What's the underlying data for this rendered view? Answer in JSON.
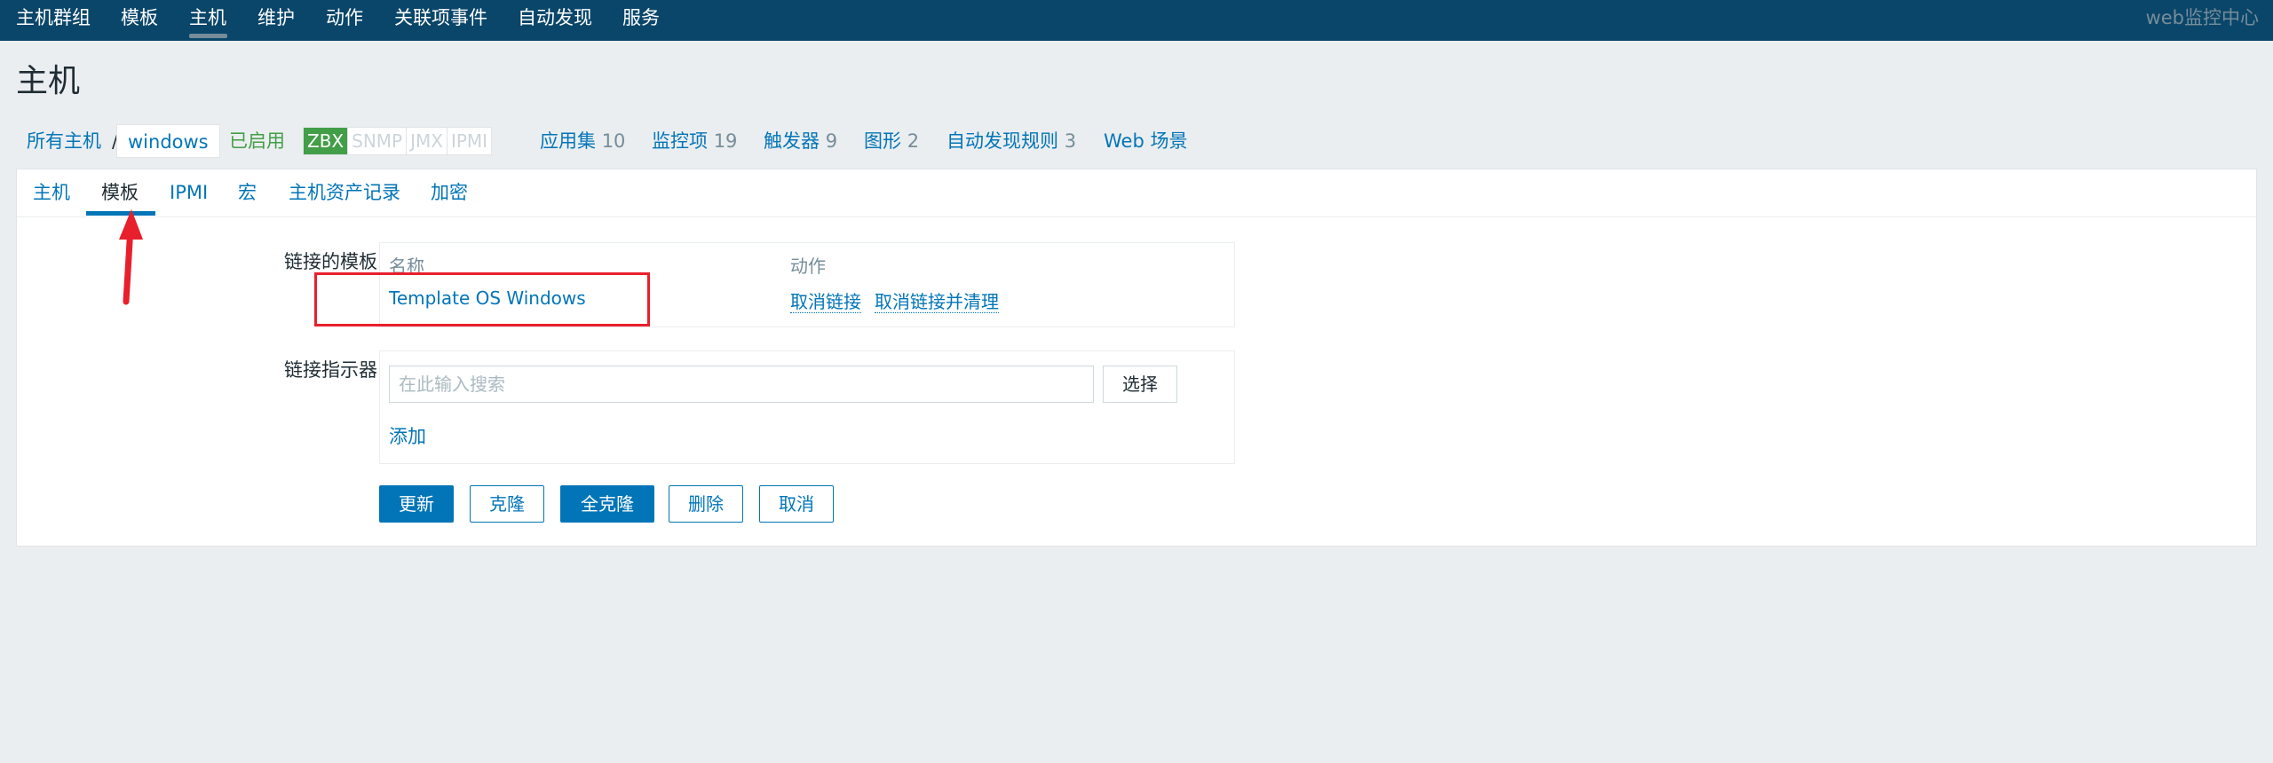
{
  "topnav": {
    "items": [
      "主机群组",
      "模板",
      "主机",
      "维护",
      "动作",
      "关联项事件",
      "自动发现",
      "服务"
    ],
    "active_index": 2,
    "brand": "web监控中心"
  },
  "page": {
    "title": "主机"
  },
  "breadcrumb": {
    "all_hosts": "所有主机",
    "separator": "/",
    "host": "windows",
    "status": "已启用",
    "availability": [
      "ZBX",
      "SNMP",
      "JMX",
      "IPMI"
    ],
    "availability_active": "ZBX",
    "links": [
      {
        "label": "应用集",
        "count": "10"
      },
      {
        "label": "监控项",
        "count": "19"
      },
      {
        "label": "触发器",
        "count": "9"
      },
      {
        "label": "图形",
        "count": "2"
      },
      {
        "label": "自动发现规则",
        "count": "3"
      },
      {
        "label": "Web 场景",
        "count": ""
      }
    ]
  },
  "tabs": {
    "items": [
      "主机",
      "模板",
      "IPMI",
      "宏",
      "主机资产记录",
      "加密"
    ],
    "active": "模板"
  },
  "form": {
    "linked_templates_label": "链接的模板",
    "table_headers": {
      "name": "名称",
      "action": "动作"
    },
    "templates": [
      {
        "name": "Template OS Windows",
        "unlink": "取消链接",
        "unlink_clear": "取消链接并清理"
      }
    ],
    "link_indicator_label": "链接指示器",
    "search_placeholder": "在此输入搜索",
    "select_button": "选择",
    "add_link": "添加"
  },
  "buttons": {
    "update": "更新",
    "clone": "克隆",
    "full_clone": "全克隆",
    "delete": "删除",
    "cancel": "取消"
  },
  "colors": {
    "header_bg": "#0a466a",
    "link": "#0275b8",
    "enabled": "#429e47",
    "annotation": "#e8202c"
  }
}
